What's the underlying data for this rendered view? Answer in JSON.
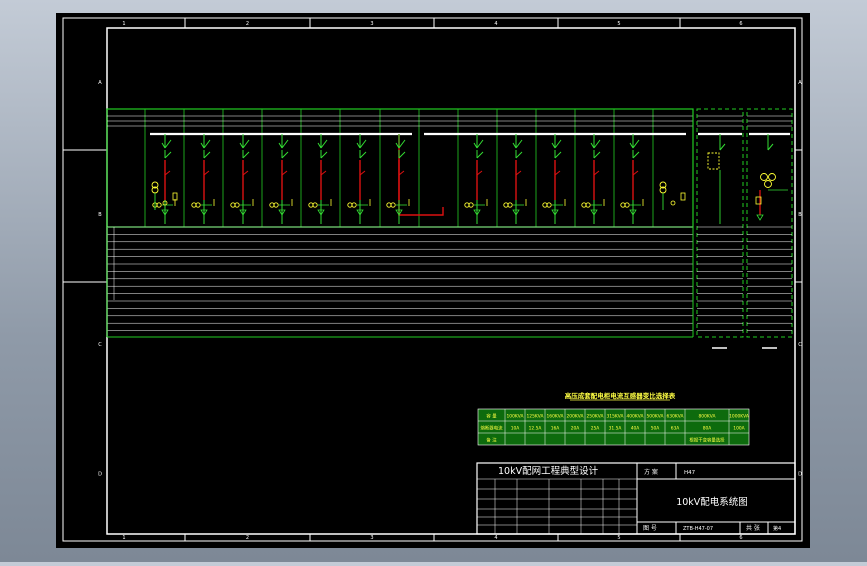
{
  "drawing": {
    "zone_numbers_top": [
      "1",
      "2",
      "3",
      "4",
      "5",
      "6"
    ],
    "zone_numbers_bottom": [
      "1",
      "2",
      "3",
      "4",
      "5",
      "6"
    ],
    "zone_letters_left": [
      "A",
      "B",
      "C",
      "D"
    ],
    "zone_letters_right": [
      "A",
      "B",
      "C",
      "D"
    ]
  },
  "title_block": {
    "project": "10kV配网工程典型设计",
    "drawing_title": "10kV配电系统图",
    "scheme_label": "方 案",
    "scheme_value": "H47",
    "sheet_label": "图 号",
    "sheet_value": "ZTB-H47-07",
    "page_label": "共 张",
    "page_value": "第4"
  },
  "load_table": {
    "title": "高压成套配电柜电流互感器变比选择表",
    "rows": [
      [
        "容 量",
        "100KVA",
        "125KVA",
        "160KVA",
        "200KVA",
        "250KVA",
        "315KVA",
        "400KVA",
        "500KVA",
        "630KVA",
        "800KVA",
        "1000KVA"
      ],
      [
        "熔断器电流",
        "10A",
        "12.5A",
        "16A",
        "20A",
        "25A",
        "31.5A",
        "40A",
        "50A",
        "63A",
        "80A",
        "100A"
      ],
      [
        "备 注",
        "",
        "",
        "",
        "",
        "",
        "",
        "",
        "",
        "",
        "根据干变容量选择",
        ""
      ]
    ]
  },
  "colors": {
    "frame": "#ffffff",
    "bus_panel": "#22cc22",
    "live_circuit": "#dd1111",
    "equipment": "#33dd33",
    "symbols": "#ffff33",
    "load_table_bg": "#0d6b0d",
    "load_table_text": "#ffff44"
  }
}
